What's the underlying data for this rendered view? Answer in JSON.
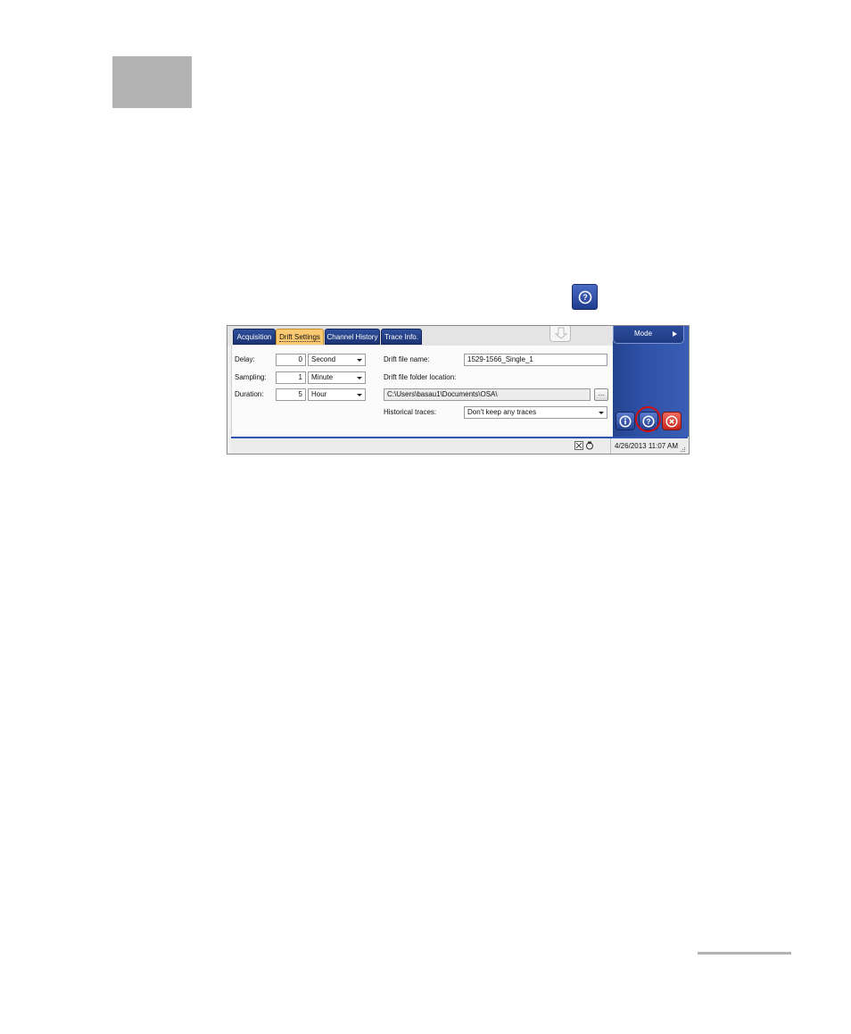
{
  "app": {
    "tabs": [
      {
        "label": "Acquisition",
        "active": false
      },
      {
        "label": "Drift Settings",
        "active": true
      },
      {
        "label": "Channel History",
        "active": false
      },
      {
        "label": "Trace Info.",
        "active": false
      }
    ],
    "mode_label": "Mode",
    "form": {
      "delay": {
        "label": "Delay:",
        "value": "0",
        "unit": "Second"
      },
      "sampling": {
        "label": "Sampling:",
        "value": "1",
        "unit": "Minute"
      },
      "duration": {
        "label": "Duration:",
        "value": "5",
        "unit": "Hour"
      },
      "drift_file_name": {
        "label": "Drift file name:",
        "value": "1529-1566_Single_1"
      },
      "drift_folder": {
        "label": "Drift file folder location:",
        "value": "C:\\Users\\basau1\\Documents\\OSA\\",
        "browse_label": "..."
      },
      "historical_traces": {
        "label": "Historical traces:",
        "value": "Don't keep any traces"
      }
    },
    "status_bar": {
      "datetime": "4/26/2013 11:07 AM"
    },
    "icons": [
      "help-icon",
      "info-icon",
      "close-icon",
      "down-arrow-icon",
      "grip-icon"
    ],
    "colors": {
      "tab_blue": "#1c3474",
      "tab_active": "#fbc96f",
      "panel_blue": "#2f52a8",
      "highlight": "#d01010",
      "close_red": "#c8261d"
    }
  }
}
